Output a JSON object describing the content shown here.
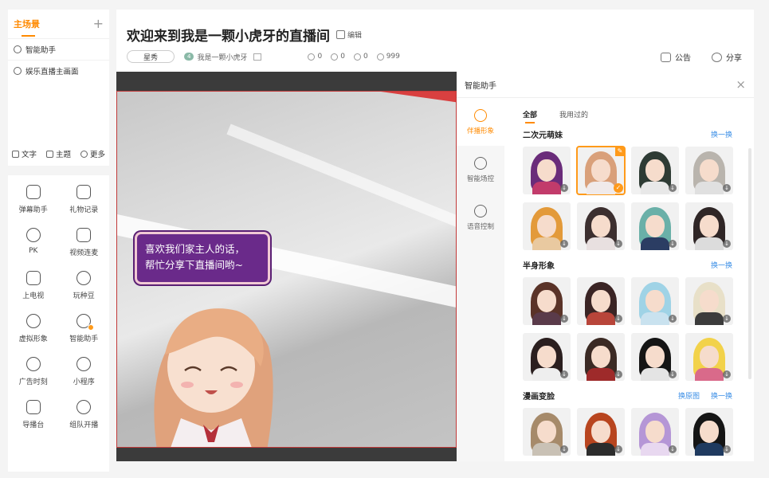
{
  "sidebar": {
    "scene_title": "主场景",
    "add_label": "+",
    "scenes": [
      {
        "label": "智能助手",
        "icon": "smile-icon"
      },
      {
        "label": "娱乐直播主画面",
        "icon": "camera-icon"
      }
    ],
    "scene_tools": [
      {
        "label": "文字",
        "icon": "text-icon"
      },
      {
        "label": "主题",
        "icon": "shirt-icon"
      },
      {
        "label": "更多",
        "icon": "more-icon"
      }
    ],
    "tools": [
      {
        "label": "弹幕助手",
        "icon": "danmaku-icon"
      },
      {
        "label": "礼物记录",
        "icon": "gift-icon"
      },
      {
        "label": "PK",
        "icon": "pk-icon"
      },
      {
        "label": "视频连麦",
        "icon": "video-link-icon"
      },
      {
        "label": "上电视",
        "icon": "tv-icon"
      },
      {
        "label": "玩种豆",
        "icon": "leaf-icon"
      },
      {
        "label": "虚拟形象",
        "icon": "virtual-avatar-icon"
      },
      {
        "label": "智能助手",
        "icon": "smart-assistant-icon"
      },
      {
        "label": "广告时刻",
        "icon": "ad-icon"
      },
      {
        "label": "小程序",
        "icon": "mini-program-icon"
      },
      {
        "label": "导播台",
        "icon": "director-icon"
      },
      {
        "label": "组队开播",
        "icon": "team-icon"
      }
    ]
  },
  "header": {
    "title": "欢迎来到我是一颗小虎牙的直播间",
    "edit_label": "编辑",
    "category_tag": "星秀",
    "level_badge": "4",
    "streamer_name": "我是一颗小虎牙",
    "stats": [
      {
        "icon": "users-icon",
        "value": "0"
      },
      {
        "icon": "heart-icon",
        "value": "0"
      },
      {
        "icon": "share-count-icon",
        "value": "0"
      },
      {
        "icon": "signal-icon",
        "value": "999"
      }
    ],
    "announcement_label": "公告",
    "share_label": "分享"
  },
  "preview": {
    "speech_line1": "喜欢我们家主人的话，",
    "speech_line2": "帮忙分享下直播间哟~"
  },
  "assistant": {
    "title": "智能助手",
    "close_label": "×",
    "nav": [
      {
        "label": "伴播形象",
        "icon": "companion-icon",
        "active": true
      },
      {
        "label": "智能场控",
        "icon": "headset-icon",
        "active": false
      },
      {
        "label": "语音控制",
        "icon": "voice-icon",
        "active": false
      }
    ],
    "tabs": [
      {
        "label": "全部",
        "active": true
      },
      {
        "label": "我用过的",
        "active": false
      }
    ],
    "sections": [
      {
        "title": "二次元萌妹",
        "links": [
          "换一换"
        ],
        "items": [
          {
            "hair": "#6a2c7a",
            "body": "#c23b6b"
          },
          {
            "hair": "#d9a07a",
            "body": "#f0eaea",
            "selected": true
          },
          {
            "hair": "#2e3b34",
            "body": "#e8e8e8"
          },
          {
            "hair": "#b9b4ad",
            "body": "#e0e0e0"
          },
          {
            "hair": "#e39a3a",
            "body": "#e9c9a0"
          },
          {
            "hair": "#3c2f2f",
            "body": "#e8e0e0"
          },
          {
            "hair": "#6ab0a8",
            "body": "#2b3d63"
          },
          {
            "hair": "#2f2626",
            "body": "#dcdcdc"
          }
        ]
      },
      {
        "title": "半身形象",
        "links": [
          "换一换"
        ],
        "items": [
          {
            "hair": "#5a3328",
            "body": "#5a3b4a"
          },
          {
            "hair": "#3a2424",
            "body": "#b8453a"
          },
          {
            "hair": "#9fd3e6",
            "body": "#c9e2ef"
          },
          {
            "hair": "#e8e0c8",
            "body": "#3c3c3c"
          },
          {
            "hair": "#2b1f1f",
            "body": "#eee"
          },
          {
            "hair": "#3b2a24",
            "body": "#9e2a2a"
          },
          {
            "hair": "#151515",
            "body": "#e4e4e4"
          },
          {
            "hair": "#f2d24a",
            "body": "#d96a8a"
          }
        ]
      },
      {
        "title": "漫画变脸",
        "links": [
          "换原图",
          "换一换"
        ],
        "items": [
          {
            "hair": "#a68a6a",
            "body": "#c9c1b5"
          },
          {
            "hair": "#b8451f",
            "body": "#2c2c2c"
          },
          {
            "hair": "#b596d6",
            "body": "#e8d8f0"
          },
          {
            "hair": "#151515",
            "body": "#1f3a5f"
          }
        ]
      }
    ]
  },
  "colors": {
    "accent": "#ff8a00",
    "link": "#3a8ee6",
    "speech_bg": "#6a2a8a"
  }
}
